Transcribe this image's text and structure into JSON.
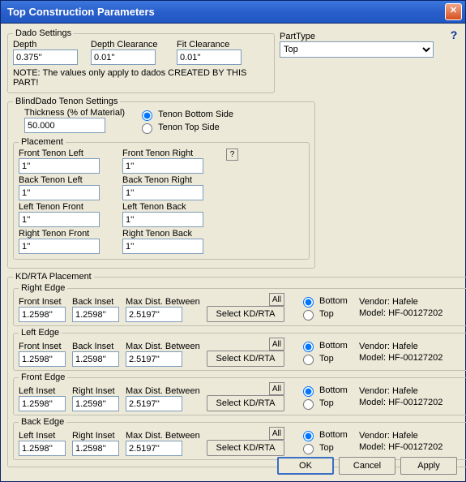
{
  "window": {
    "title": "Top Construction Parameters"
  },
  "help_icon": "?",
  "dado": {
    "legend": "Dado Settings",
    "depth_label": "Depth",
    "depth_value": "0.375''",
    "depth_clear_label": "Depth Clearance",
    "depth_clear_value": "0.01''",
    "fit_clear_label": "Fit Clearance",
    "fit_clear_value": "0.01''",
    "note": "NOTE: The values only apply to dados CREATED BY THIS PART!"
  },
  "parttype": {
    "label": "PartType",
    "value": "Top"
  },
  "blind": {
    "legend": "BlindDado Tenon Settings",
    "thickness_label": "Thickness (% of Material)",
    "thickness_value": "50.000",
    "radio_bottom": "Tenon Bottom Side",
    "radio_top": "Tenon Top Side",
    "placement_legend": "Placement",
    "help": "?",
    "fields": {
      "ftl_label": "Front Tenon Left",
      "ftl_value": "1''",
      "ftr_label": "Front Tenon Right",
      "ftr_value": "1''",
      "btl_label": "Back Tenon Left",
      "btl_value": "1''",
      "btr_label": "Back Tenon Right",
      "btr_value": "1''",
      "ltf_label": "Left Tenon Front",
      "ltf_value": "1''",
      "ltb_label": "Left Tenon Back",
      "ltb_value": "1''",
      "rtf_label": "Right Tenon Front",
      "rtf_value": "1''",
      "rtb_label": "Right Tenon Back",
      "rtb_value": "1''"
    }
  },
  "kd": {
    "legend": "KD/RTA Placement",
    "all_label": "All",
    "select_label": "Select KD/RTA",
    "radio_bottom": "Bottom",
    "radio_top": "Top",
    "vendor_label": "Vendor: Hafele",
    "model_label": "Model: HF-00127202",
    "edges": {
      "right": {
        "legend": "Right Edge",
        "a_label": "Front Inset",
        "a_value": "1.2598''",
        "b_label": "Back Inset",
        "b_value": "1.2598''",
        "c_label": "Max Dist. Between",
        "c_value": "2.5197''"
      },
      "left": {
        "legend": "Left Edge",
        "a_label": "Front Inset",
        "a_value": "1.2598''",
        "b_label": "Back Inset",
        "b_value": "1.2598''",
        "c_label": "Max Dist. Between",
        "c_value": "2.5197''"
      },
      "front": {
        "legend": "Front Edge",
        "a_label": "Left Inset",
        "a_value": "1.2598''",
        "b_label": "Right Inset",
        "b_value": "1.2598''",
        "c_label": "Max Dist. Between",
        "c_value": "2.5197''"
      },
      "back": {
        "legend": "Back Edge",
        "a_label": "Left Inset",
        "a_value": "1.2598''",
        "b_label": "Right Inset",
        "b_value": "1.2598''",
        "c_label": "Max Dist. Between",
        "c_value": "2.5197''"
      }
    }
  },
  "buttons": {
    "ok": "OK",
    "cancel": "Cancel",
    "apply": "Apply"
  }
}
